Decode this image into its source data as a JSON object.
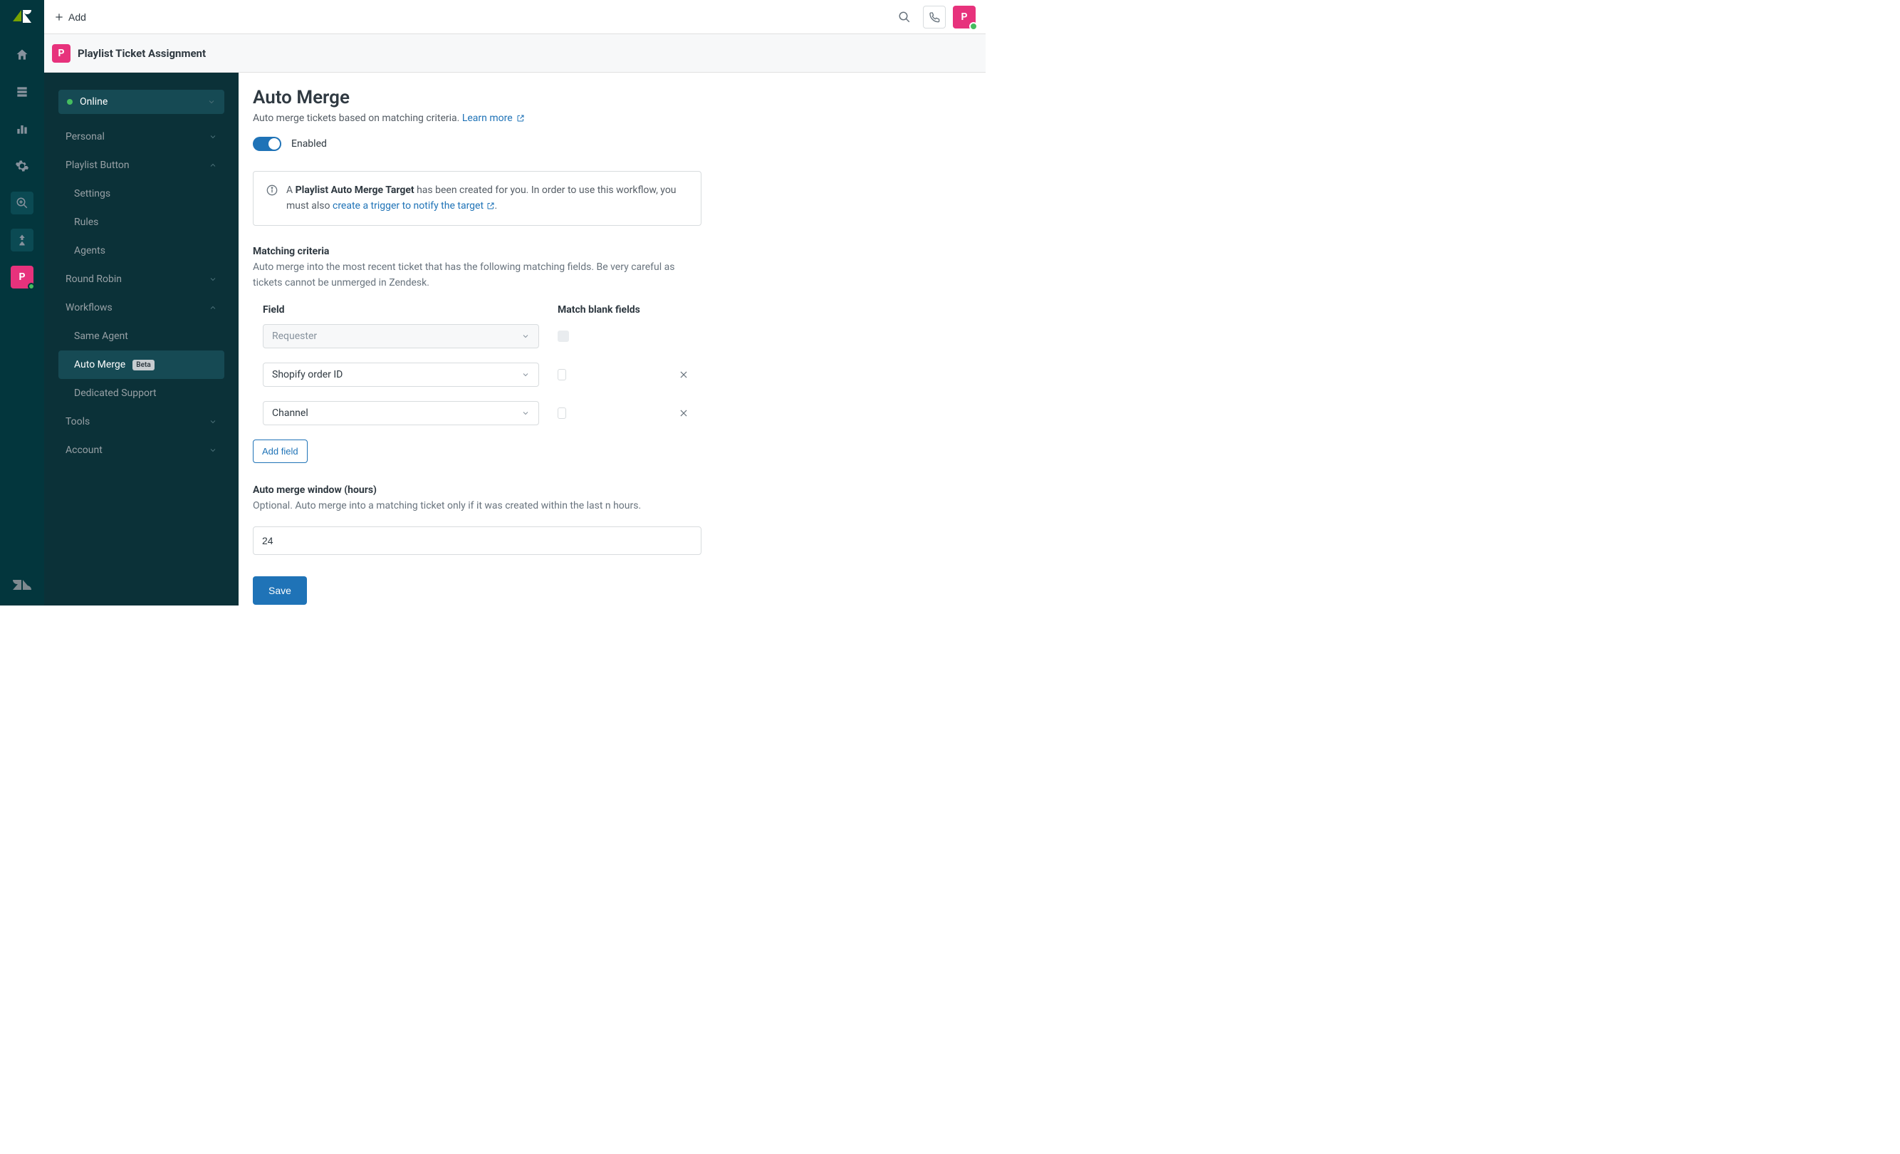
{
  "topbar": {
    "add_label": "Add",
    "avatar_initial": "P"
  },
  "appheader": {
    "badge_initial": "P",
    "title": "Playlist Ticket Assignment"
  },
  "sidebar": {
    "status_label": "Online",
    "items": {
      "personal": "Personal",
      "playlist_button": "Playlist Button",
      "settings": "Settings",
      "rules": "Rules",
      "agents": "Agents",
      "round_robin": "Round Robin",
      "workflows": "Workflows",
      "same_agent": "Same Agent",
      "auto_merge": "Auto Merge",
      "auto_merge_badge": "Beta",
      "dedicated_support": "Dedicated Support",
      "tools": "Tools",
      "account": "Account"
    }
  },
  "content": {
    "heading": "Auto Merge",
    "subtitle": "Auto merge tickets based on matching criteria.",
    "learn_more": "Learn more",
    "enabled_label": "Enabled",
    "info_prefix": "A ",
    "info_bold": "Playlist Auto Merge Target",
    "info_mid": " has been created for you. In order to use this workflow, you must also ",
    "info_link": "create a trigger to notify the target",
    "info_suffix": ".",
    "criteria_label": "Matching criteria",
    "criteria_help": "Auto merge into the most recent ticket that has the following matching fields. Be very careful as tickets cannot be unmerged in Zendesk.",
    "col_field": "Field",
    "col_blank": "Match blank fields",
    "field_rows": [
      {
        "value": "Requester",
        "disabled": true,
        "checkbox_disabled": true,
        "removable": false
      },
      {
        "value": "Shopify order ID",
        "disabled": false,
        "checkbox_disabled": false,
        "removable": true
      },
      {
        "value": "Channel",
        "disabled": false,
        "checkbox_disabled": false,
        "removable": true
      }
    ],
    "add_field_label": "Add field",
    "window_label": "Auto merge window (hours)",
    "window_help": "Optional. Auto merge into a matching ticket only if it was created within the last n hours.",
    "window_value": "24",
    "save_label": "Save"
  }
}
